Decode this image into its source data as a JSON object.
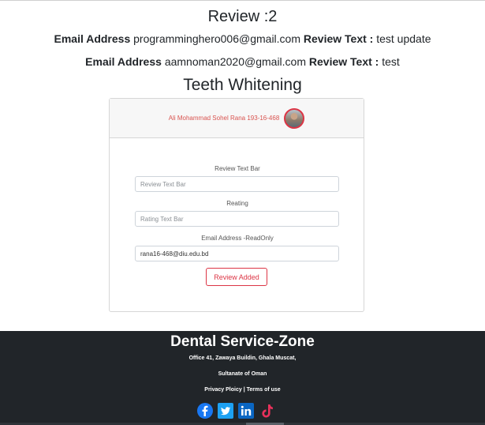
{
  "reviews": {
    "heading": "Review :2",
    "items": [
      {
        "email_label": "Email Address",
        "email": "programminghero006@gmail.com",
        "text_label": "Review Text :",
        "text": "test update"
      },
      {
        "email_label": "Email Address",
        "email": "aamnoman2020@gmail.com",
        "text_label": "Review Text :",
        "text": "test"
      }
    ]
  },
  "service": {
    "title": "Teeth Whitening"
  },
  "form": {
    "user_name": "Ali Mohammad Sohel Rana 193-16-468",
    "review_label": "Review Text Bar",
    "review_placeholder": "Review Text Bar",
    "rating_label": "Reating",
    "rating_placeholder": "Rating Text Bar",
    "email_label": "Email Address -ReadOnly",
    "email_value": "rana16-468@diu.edu.bd",
    "submit_label": "Review Added",
    "accent_color": "#dc3545"
  },
  "footer": {
    "title": "Dental Service-Zone",
    "address_line1": "Office 41, Zawaya Buildin, Ghala Muscat,",
    "address_line2": "Sultanate of Oman",
    "privacy": "Privacy Ploicy",
    "separator": "|",
    "terms": "Terms of use",
    "social": [
      "facebook-icon",
      "twitter-icon",
      "linkedin-icon",
      "tiktok-icon"
    ],
    "background": "#212529"
  }
}
